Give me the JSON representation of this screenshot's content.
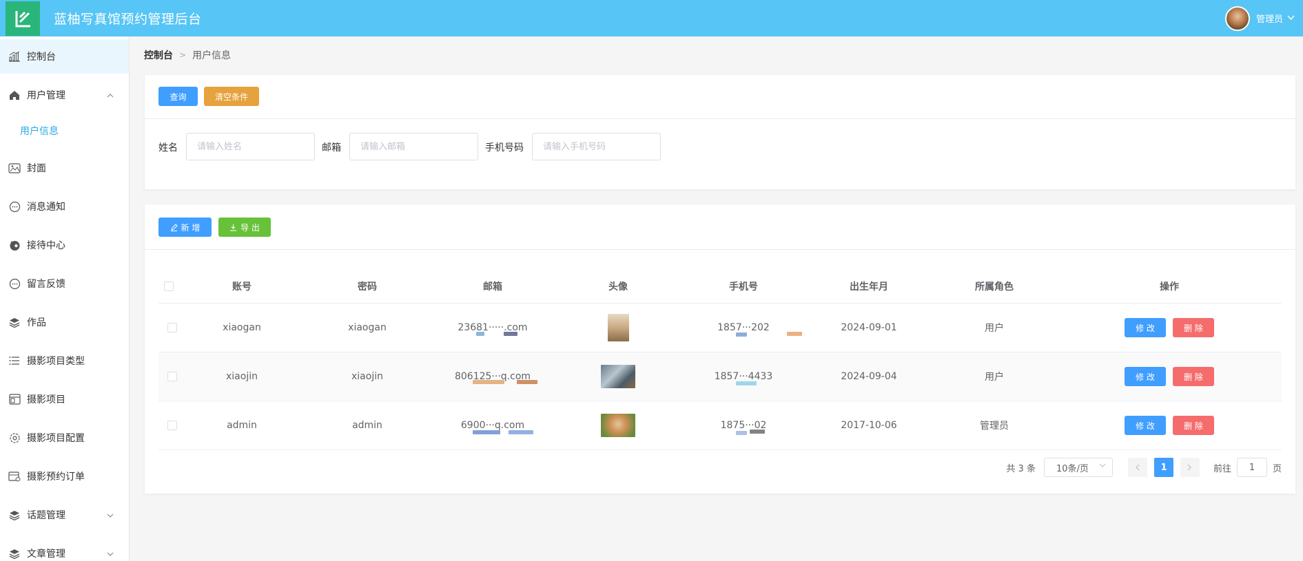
{
  "header": {
    "title": "蓝柚写真馆预约管理后台",
    "user_name": "管理员",
    "caret": "⌵"
  },
  "sidebar": {
    "items": [
      {
        "label": "控制台",
        "icon": "chart-icon",
        "active": true
      },
      {
        "label": "用户管理",
        "icon": "home-icon",
        "expanded": true
      },
      {
        "label": "用户信息",
        "submenu": true
      },
      {
        "label": "封面",
        "icon": "image-icon"
      },
      {
        "label": "消息通知",
        "icon": "chat-bubble-icon"
      },
      {
        "label": "接待中心",
        "icon": "service-icon"
      },
      {
        "label": "留言反馈",
        "icon": "chat-bubble-icon"
      },
      {
        "label": "作品",
        "icon": "layers-icon"
      },
      {
        "label": "摄影项目类型",
        "icon": "list-icon"
      },
      {
        "label": "摄影项目",
        "icon": "window-icon"
      },
      {
        "label": "摄影项目配置",
        "icon": "gear-icon"
      },
      {
        "label": "摄影预约订单",
        "icon": "order-icon"
      },
      {
        "label": "话题管理",
        "icon": "layers-icon",
        "collapsed": true
      },
      {
        "label": "文章管理",
        "icon": "layers-icon",
        "collapsed": true
      }
    ]
  },
  "breadcrumb": {
    "root": "控制台",
    "current": "用户信息"
  },
  "search": {
    "query_label": "查询",
    "clear_label": "清空条件",
    "fields": [
      {
        "label": "姓名",
        "placeholder": "请输入姓名"
      },
      {
        "label": "邮箱",
        "placeholder": "请输入邮箱"
      },
      {
        "label": "手机号码",
        "placeholder": "请输入手机号码"
      }
    ]
  },
  "toolbar": {
    "add_label": "新 增",
    "export_label": "导 出"
  },
  "table": {
    "columns": [
      "账号",
      "密码",
      "邮箱",
      "头像",
      "手机号",
      "出生年月",
      "所属角色",
      "操作"
    ],
    "rows": [
      {
        "account": "xiaogan",
        "password": "xiaogan",
        "email": "23681·····.com",
        "phone": "1857···202",
        "birth": "2024-09-01",
        "role": "用户"
      },
      {
        "account": "xiaojin",
        "password": "xiaojin",
        "email": "806125···q.com",
        "phone": "1857···4433",
        "birth": "2024-09-04",
        "role": "用户"
      },
      {
        "account": "admin",
        "password": "admin",
        "email": "6900···q.com",
        "phone": "1875···02",
        "birth": "2017-10-06",
        "role": "管理员"
      }
    ],
    "edit_label": "修 改",
    "delete_label": "删 除"
  },
  "pagination": {
    "total": "共 3 条",
    "page_size": "10条/页",
    "current_page": "1",
    "goto_label": "前往",
    "goto_value": "1",
    "page_suffix": "页"
  },
  "colors": {
    "header": "#57c5f5",
    "logo": "#2ab57a",
    "primary": "#409eff",
    "warning": "#e6a23c",
    "success": "#67c23a",
    "danger": "#f56c6c",
    "active_menu_text": "#2aa9e8"
  }
}
